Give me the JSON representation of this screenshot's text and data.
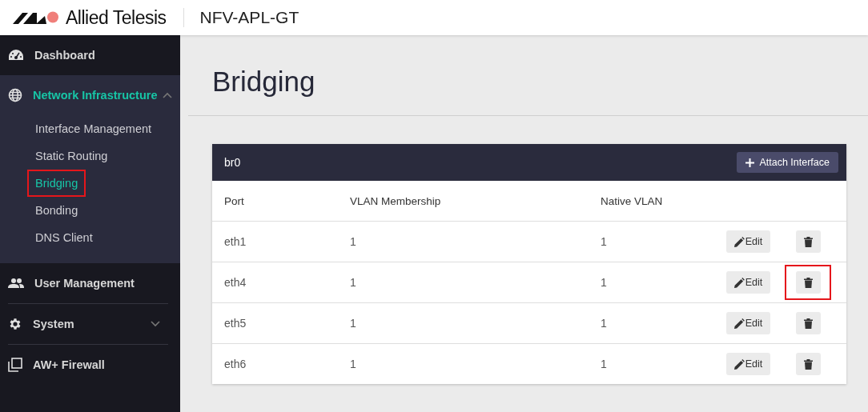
{
  "header": {
    "brand": "Allied Telesis",
    "device": "NFV-APL-GT"
  },
  "sidebar": {
    "items": [
      {
        "kind": "link",
        "label": "Dashboard",
        "selected": false
      },
      {
        "kind": "group",
        "label": "Network Infrastructure",
        "expanded": true,
        "selected": true,
        "children": [
          {
            "label": "Interface Management",
            "selected": false,
            "highlighted": false
          },
          {
            "label": "Static Routing",
            "selected": false,
            "highlighted": false
          },
          {
            "label": "Bridging",
            "selected": true,
            "highlighted": true
          },
          {
            "label": "Bonding",
            "selected": false,
            "highlighted": false
          },
          {
            "label": "DNS Client",
            "selected": false,
            "highlighted": false
          }
        ]
      },
      {
        "kind": "link",
        "label": "User Management",
        "selected": false
      },
      {
        "kind": "group",
        "label": "System",
        "expanded": false,
        "selected": false
      },
      {
        "kind": "link",
        "label": "AW+ Firewall",
        "selected": false
      }
    ]
  },
  "page": {
    "title": "Bridging"
  },
  "bridge": {
    "name": "br0",
    "attach_button": "Attach Interface",
    "columns": [
      "Port",
      "VLAN Membership",
      "Native VLAN"
    ],
    "rows": [
      {
        "port": "eth1",
        "vlan_membership": "1",
        "native_vlan": "1",
        "edit": "Edit",
        "delete_highlighted": false
      },
      {
        "port": "eth4",
        "vlan_membership": "1",
        "native_vlan": "1",
        "edit": "Edit",
        "delete_highlighted": true
      },
      {
        "port": "eth5",
        "vlan_membership": "1",
        "native_vlan": "1",
        "edit": "Edit",
        "delete_highlighted": false
      },
      {
        "port": "eth6",
        "vlan_membership": "1",
        "native_vlan": "1",
        "edit": "Edit",
        "delete_highlighted": false
      }
    ]
  }
}
